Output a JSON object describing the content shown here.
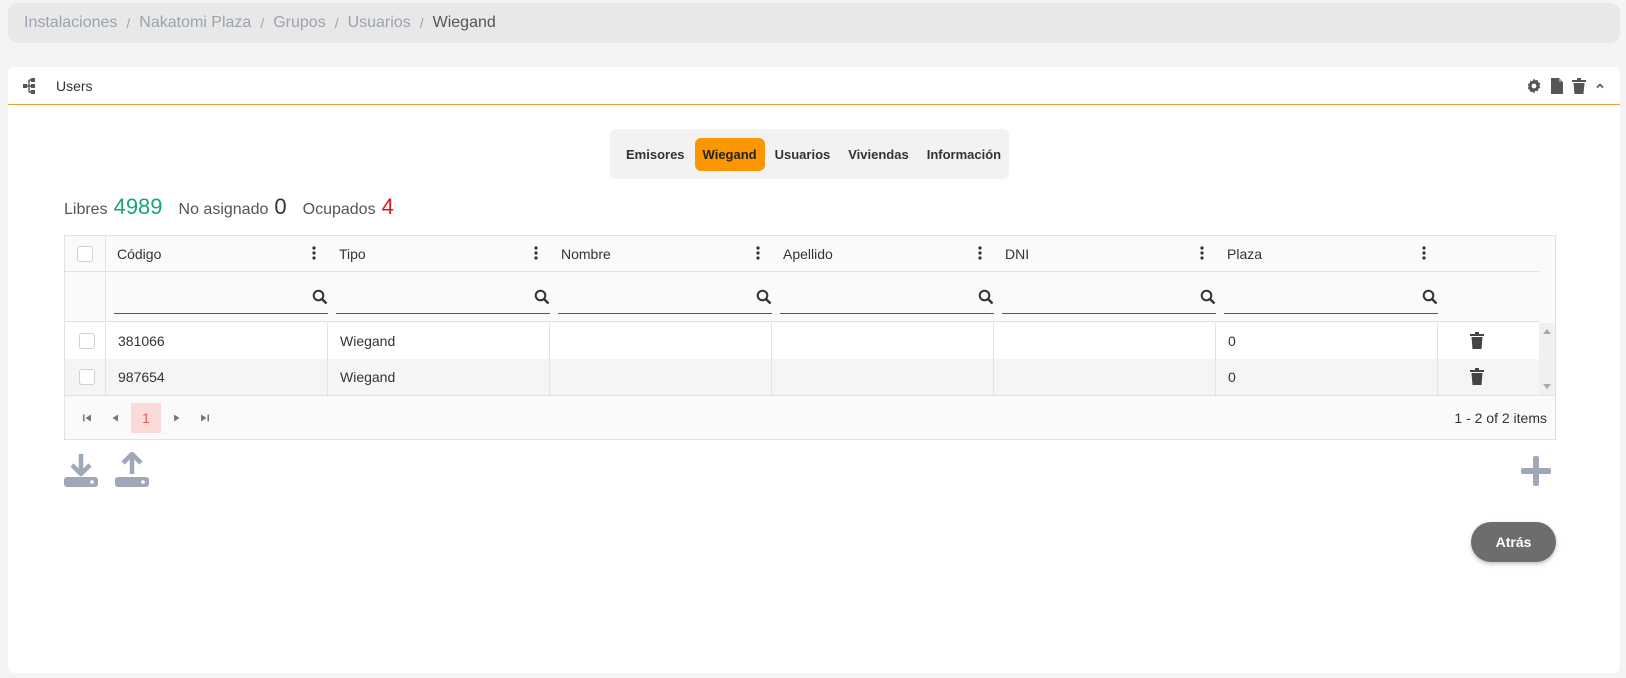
{
  "breadcrumb": {
    "items": [
      "Instalaciones",
      "Nakatomi Plaza",
      "Grupos",
      "Usuarios"
    ],
    "separator": "/",
    "current": "Wiegand"
  },
  "card": {
    "title": "Users",
    "header_icons": [
      "settings-icon",
      "document-icon",
      "trash-icon",
      "chevron-up-icon"
    ]
  },
  "tabs": {
    "items": [
      "Emisores",
      "Wiegand",
      "Usuarios",
      "Viviendas",
      "Información"
    ],
    "active": "Wiegand"
  },
  "counters": {
    "free_label": "Libres",
    "free_value": "4989",
    "unassigned_label": "No asignado",
    "unassigned_value": "0",
    "occupied_label": "Ocupados",
    "occupied_value": "4"
  },
  "grid": {
    "columns": [
      "Código",
      "Tipo",
      "Nombre",
      "Apellido",
      "DNI",
      "Plaza"
    ],
    "rows": [
      [
        "381066",
        "Wiegand",
        "",
        "",
        "",
        "0"
      ],
      [
        "987654",
        "Wiegand",
        "",
        "",
        "",
        "0"
      ]
    ],
    "pager": {
      "current_page": "1",
      "info": "1 - 2 of 2 items"
    }
  },
  "actions": {
    "back_label": "Atrás"
  },
  "colors": {
    "accent": "#fc9601",
    "free": "#1aa57c",
    "occupied": "#e0191b",
    "active_page_bg": "#fbdada"
  }
}
